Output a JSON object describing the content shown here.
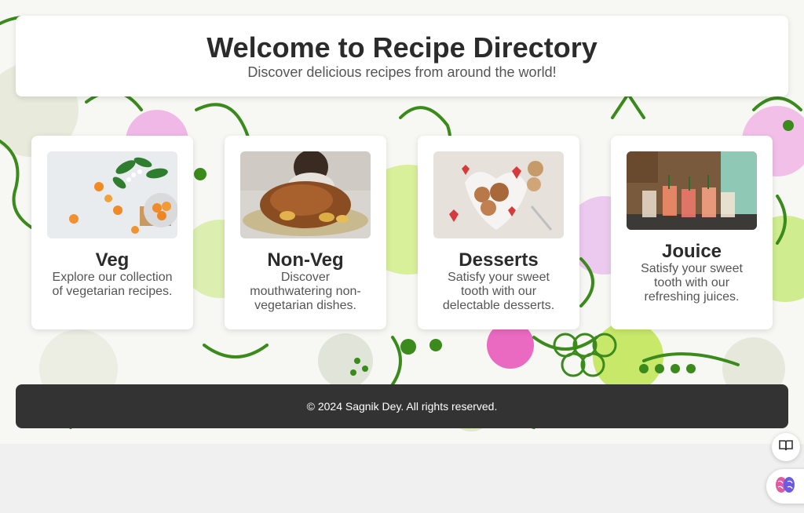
{
  "header": {
    "title": "Welcome to Recipe Directory",
    "subtitle": "Discover delicious recipes from around the world!"
  },
  "cards": [
    {
      "title": "Veg",
      "description": "Explore our collection of vegetarian recipes.",
      "image": "vegetables-photo"
    },
    {
      "title": "Non-Veg",
      "description": "Discover mouthwatering non-vegetarian dishes.",
      "image": "roast-chicken-photo"
    },
    {
      "title": "Desserts",
      "description": "Satisfy your sweet tooth with our delectable desserts.",
      "image": "desserts-photo"
    },
    {
      "title": "Jouice",
      "description": "Satisfy your sweet tooth with our refreshing juices.",
      "image": "juices-photo"
    }
  ],
  "footer": {
    "text": "© 2024 Sagnik Dey. All rights reserved."
  },
  "floating": {
    "reader_icon": "reader-mode-icon",
    "assistant_icon": "brain-icon"
  },
  "colors": {
    "header_text": "#2b2b2b",
    "footer_bg": "#333333",
    "doodle_green": "#3a8a1c",
    "blob_lime": "#c8e86a",
    "blob_pink": "#e96ac0"
  }
}
